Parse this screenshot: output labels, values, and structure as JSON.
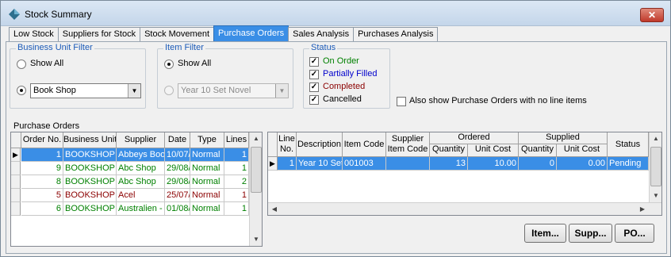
{
  "window": {
    "title": "Stock Summary",
    "close_label": "✕"
  },
  "tabs": [
    {
      "label": "Low Stock"
    },
    {
      "label": "Suppliers for Stock"
    },
    {
      "label": "Stock Movement"
    },
    {
      "label": "Purchase Orders",
      "active": true
    },
    {
      "label": "Sales Analysis"
    },
    {
      "label": "Purchases Analysis"
    }
  ],
  "business_unit_filter": {
    "legend": "Business Unit Filter",
    "show_all_label": "Show All",
    "selected_option": "specific",
    "combo_value": "Book Shop"
  },
  "item_filter": {
    "legend": "Item Filter",
    "show_all_label": "Show All",
    "selected_option": "show_all",
    "combo_value": "Year 10 Set Novel"
  },
  "status_filter": {
    "legend": "Status",
    "items": [
      {
        "label": "On Order",
        "checked": true,
        "color": "#008000"
      },
      {
        "label": "Partially Filled",
        "checked": true,
        "color": "#0000cc"
      },
      {
        "label": "Completed",
        "checked": true,
        "color": "#8b0000"
      },
      {
        "label": "Cancelled",
        "checked": true,
        "color": "#000000"
      }
    ]
  },
  "also_show": {
    "label": "Also show Purchase Orders with no line items",
    "checked": false
  },
  "purchase_orders": {
    "title": "Purchase Orders",
    "columns": [
      "Order No.",
      "Business Unit",
      "Supplier",
      "Date",
      "Type",
      "Lines"
    ],
    "rows": [
      {
        "cells": [
          "1",
          "BOOKSHOP",
          "Abbeys Boo",
          "10/07/",
          "Normal",
          "1"
        ],
        "selected": true,
        "color": "#ffffff"
      },
      {
        "cells": [
          "9",
          "BOOKSHOP",
          "Abc Shop",
          "29/08/",
          "Normal",
          "1"
        ],
        "color": "#008000"
      },
      {
        "cells": [
          "8",
          "BOOKSHOP",
          "Abc Shop",
          "29/08/",
          "Normal",
          "2"
        ],
        "color": "#008000"
      },
      {
        "cells": [
          "5",
          "BOOKSHOP",
          "Acel",
          "25/07/",
          "Normal",
          "1"
        ],
        "color": "#8b0000"
      },
      {
        "cells": [
          "6",
          "BOOKSHOP",
          "Australien -",
          "01/08/",
          "Normal",
          "1"
        ],
        "color": "#008000"
      }
    ]
  },
  "line_items": {
    "columns": {
      "line_no": "Line No.",
      "description": "Description",
      "item_code": "Item Code",
      "supplier_item_code": "Supplier Item Code",
      "ordered_group": "Ordered",
      "ordered_qty": "Quantity",
      "ordered_cost": "Unit Cost",
      "supplied_group": "Supplied",
      "supplied_qty": "Quantity",
      "supplied_cost": "Unit Cost",
      "status": "Status"
    },
    "rows": [
      {
        "cells": [
          "1",
          "Year 10 Set",
          "001003",
          "",
          "13",
          "10.00",
          "0",
          "0.00",
          "Pending"
        ],
        "selected": true
      }
    ]
  },
  "buttons": {
    "item": "Item...",
    "supp": "Supp...",
    "po": "PO..."
  },
  "colors": {
    "selection": "#3a8ee6",
    "accent": "#1c5bb8"
  }
}
